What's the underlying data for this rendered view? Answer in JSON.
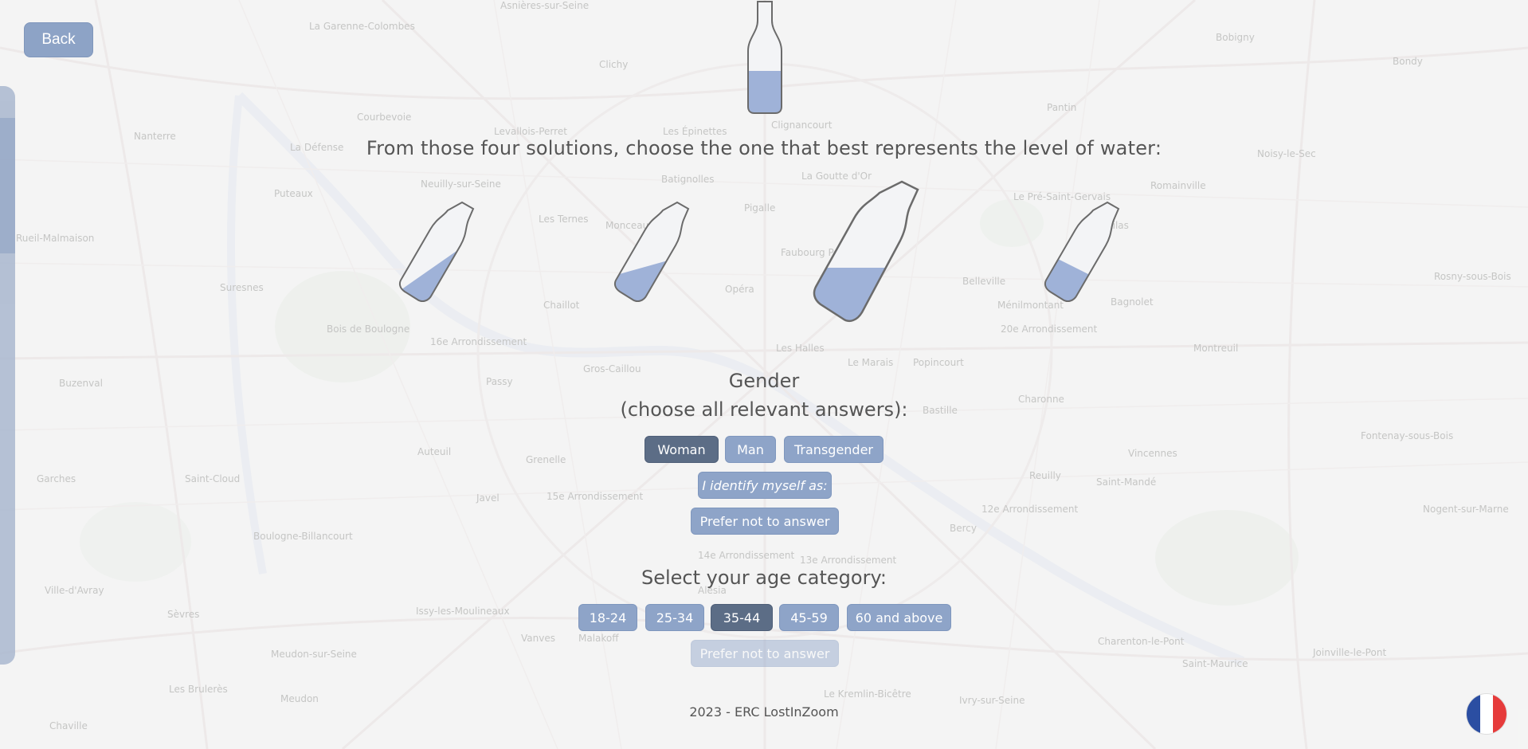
{
  "map": {
    "labels": [
      "Asnières-sur-Seine",
      "La Garenne-Colombes",
      "Clichy",
      "Nanterre",
      "Courbevoie",
      "Levallois-Perret",
      "Les Épinettes",
      "Clignancourt",
      "Pantin",
      "Bobigny",
      "Bondy",
      "La Défense",
      "Neuilly-sur-Seine",
      "Batignolles",
      "La Goutte d'Or",
      "Le Pré-Saint-Gervais",
      "Romainville",
      "Noisy-le-Sec",
      "Puteaux",
      "Les Ternes",
      "Pigalle",
      "Les Lilas",
      "Rueil-Malmaison",
      "Monceau",
      "Faubourg Poissonnière",
      "Belleville",
      "Bagnolet",
      "Rosny-sous-Bois",
      "Suresnes",
      "Chaillot",
      "Opéra",
      "Ménilmontant",
      "Montreuil",
      "Bois de Boulogne",
      "16e Arrondissement",
      "Les Halles",
      "20e Arrondissement",
      "Le Marais",
      "Popincourt",
      "Passy",
      "Gros-Caillou",
      "Buzenval",
      "Charonne",
      "Bastille",
      "Auteuil",
      "Grenelle",
      "Vincennes",
      "Fontenay-sous-Bois",
      "Garches",
      "Saint-Cloud",
      "Javel",
      "15e Arrondissement",
      "Reuilly",
      "Saint-Mandé",
      "Boulogne-Billancourt",
      "12e Arrondissement",
      "Bercy",
      "Nogent-sur-Marne",
      "14e Arrondissement",
      "13e Arrondissement",
      "Ville-d'Avray",
      "Sèvres",
      "Issy-les-Moulineaux",
      "Alésia",
      "Vanves",
      "Malakoff",
      "Charenton-le-Pont",
      "Joinville-le-Pont",
      "Meudon-sur-Seine",
      "Saint-Maurice",
      "Les Brulerès",
      "Meudon",
      "Le Kremlin-Bicêtre",
      "Ivry-sur-Seine",
      "Chaville"
    ]
  },
  "back_label": "Back",
  "question": "From those four solutions, choose the one that best represents the level of water:",
  "colors": {
    "water": "#9fb2d8",
    "button": "#8ea4c8",
    "selected": "#5c6d86"
  },
  "gender": {
    "title": "Gender",
    "subtitle": "(choose all relevant answers):",
    "options": [
      "Woman",
      "Man",
      "Transgender"
    ],
    "selected": "Woman",
    "identify_label": "I identify myself as:",
    "prefer_not": "Prefer not to answer"
  },
  "age": {
    "title": "Select your age category:",
    "options": [
      "18-24",
      "25-34",
      "35-44",
      "45-59",
      "60 and above"
    ],
    "selected": "35-44",
    "prefer_not": "Prefer not to answer"
  },
  "footer": "2023 - ERC LostInZoom",
  "language_icon": "france-flag-icon"
}
